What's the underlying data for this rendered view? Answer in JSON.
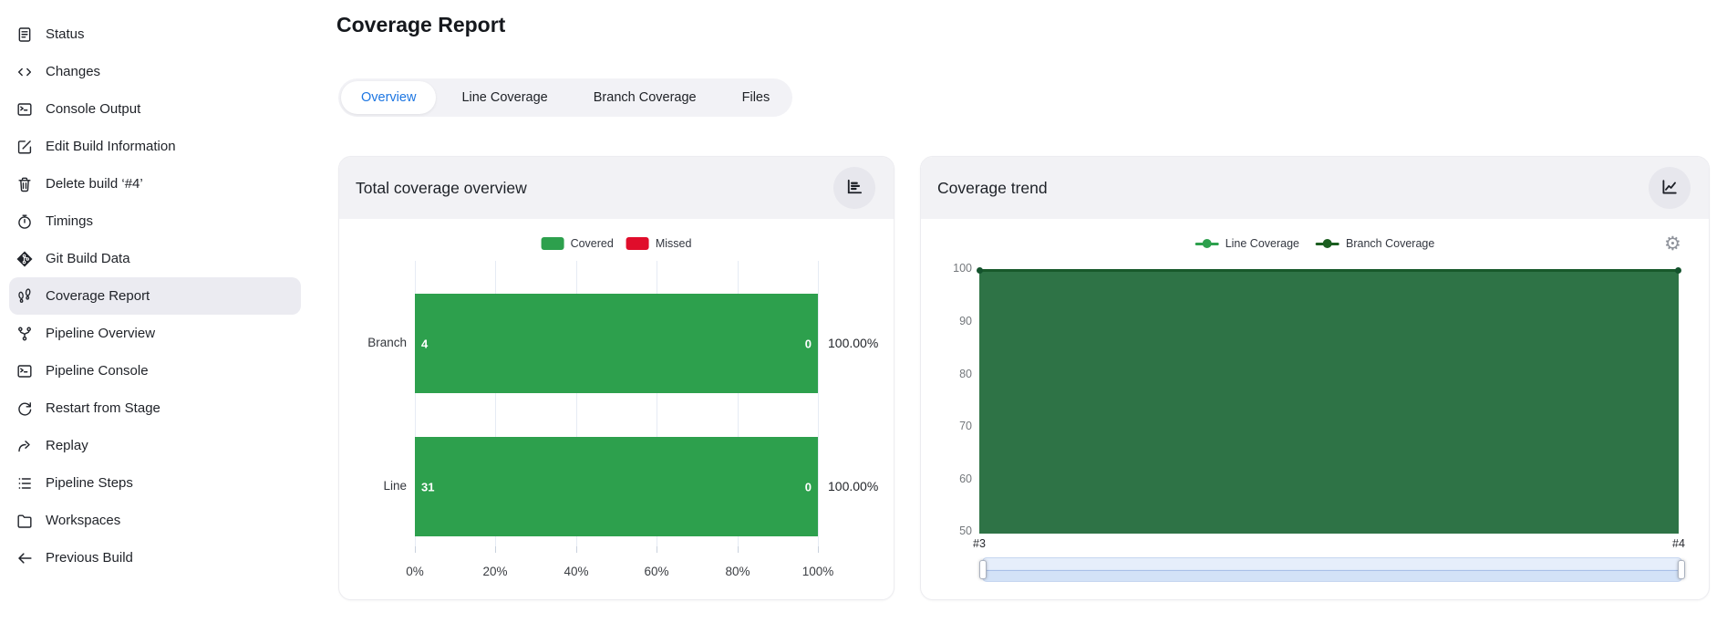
{
  "app": {
    "title": "Coverage Report"
  },
  "sidebar": {
    "items": [
      {
        "label": "Status",
        "icon": "status-document-icon"
      },
      {
        "label": "Changes",
        "icon": "code-icon"
      },
      {
        "label": "Console Output",
        "icon": "terminal-icon"
      },
      {
        "label": "Edit Build Information",
        "icon": "edit-icon"
      },
      {
        "label": "Delete build ‘#4’",
        "icon": "trash-icon"
      },
      {
        "label": "Timings",
        "icon": "stopwatch-icon"
      },
      {
        "label": "Git Build Data",
        "icon": "git-icon"
      },
      {
        "label": "Coverage Report",
        "icon": "footprints-icon",
        "active": true
      },
      {
        "label": "Pipeline Overview",
        "icon": "branch-icon"
      },
      {
        "label": "Pipeline Console",
        "icon": "terminal-icon"
      },
      {
        "label": "Restart from Stage",
        "icon": "restart-icon"
      },
      {
        "label": "Replay",
        "icon": "replay-icon"
      },
      {
        "label": "Pipeline Steps",
        "icon": "steps-icon"
      },
      {
        "label": "Workspaces",
        "icon": "folder-icon"
      },
      {
        "label": "Previous Build",
        "icon": "arrow-left-icon"
      }
    ]
  },
  "tabs": [
    {
      "label": "Overview",
      "active": true
    },
    {
      "label": "Line Coverage"
    },
    {
      "label": "Branch Coverage"
    },
    {
      "label": "Files"
    }
  ],
  "icons": {
    "gear_glyph": "⚙"
  },
  "colors": {
    "accent_blue": "#1d76e2",
    "covered_green": "#2da04d",
    "missed_red": "#e00d2b",
    "trend_area_fill": "#2e7346",
    "trend_branch_line": "#1b5e20",
    "zoom_slider_blue": "#d3e2f7"
  },
  "chart_data": [
    {
      "type": "bar",
      "title": "Total coverage overview",
      "orientation": "horizontal",
      "categories": [
        "Branch",
        "Line"
      ],
      "series": [
        {
          "name": "Covered",
          "color": "#2da04d",
          "values": [
            4,
            31
          ]
        },
        {
          "name": "Missed",
          "color": "#e00d2b",
          "values": [
            0,
            0
          ]
        }
      ],
      "percent_labels": [
        "100.00%",
        "100.00%"
      ],
      "x_ticks": [
        "0%",
        "20%",
        "40%",
        "60%",
        "80%",
        "100%"
      ],
      "xlim": [
        0,
        100
      ],
      "legend_position": "top",
      "grid": "vertical-lines"
    },
    {
      "type": "area",
      "title": "Coverage trend",
      "x": [
        "#3",
        "#4"
      ],
      "series": [
        {
          "name": "Line Coverage",
          "color": "#2da04d",
          "values": [
            100,
            100
          ]
        },
        {
          "name": "Branch Coverage",
          "color": "#1b5e20",
          "values": [
            100,
            100
          ]
        }
      ],
      "y_ticks": [
        "100",
        "90",
        "80",
        "70",
        "60",
        "50"
      ],
      "ylim": [
        50,
        100
      ],
      "legend_position": "top",
      "has_zoom_slider": true
    }
  ]
}
